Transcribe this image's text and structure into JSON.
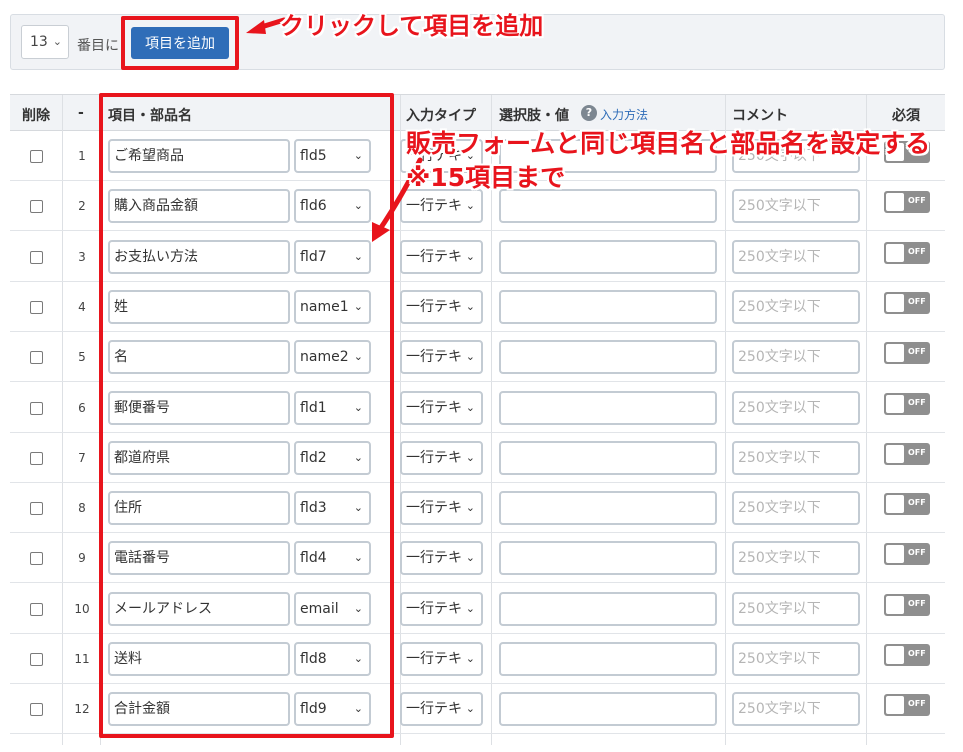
{
  "toolbar": {
    "position_value": "13",
    "position_suffix": "番目に",
    "add_button": "項目を追加"
  },
  "annotations": {
    "add_hint": "クリックして項目を追加",
    "main_line1": "販売フォームと同じ項目名と部品名を設定する",
    "main_line2": "※15項目まで"
  },
  "table": {
    "headers": {
      "delete": "削除",
      "num": "-",
      "name": "項目・部品名",
      "type": "入力タイプ",
      "choices": "選択肢・値",
      "choices_help": "入力方法",
      "comment": "コメント",
      "required": "必須"
    },
    "rows": [
      {
        "num": "1",
        "name": "ご希望商品",
        "part": "fld5",
        "type": "一行テキ",
        "comment_ph": "250文字以下",
        "toggle": "OFF"
      },
      {
        "num": "2",
        "name": "購入商品金額",
        "part": "fld6",
        "type": "一行テキ",
        "comment_ph": "250文字以下",
        "toggle": "OFF"
      },
      {
        "num": "3",
        "name": "お支払い方法",
        "part": "fld7",
        "type": "一行テキ",
        "comment_ph": "250文字以下",
        "toggle": "OFF"
      },
      {
        "num": "4",
        "name": "姓",
        "part": "name1",
        "type": "一行テキ",
        "comment_ph": "250文字以下",
        "toggle": "OFF"
      },
      {
        "num": "5",
        "name": "名",
        "part": "name2",
        "type": "一行テキ",
        "comment_ph": "250文字以下",
        "toggle": "OFF"
      },
      {
        "num": "6",
        "name": "郵便番号",
        "part": "fld1",
        "type": "一行テキ",
        "comment_ph": "250文字以下",
        "toggle": "OFF"
      },
      {
        "num": "7",
        "name": "都道府県",
        "part": "fld2",
        "type": "一行テキ",
        "comment_ph": "250文字以下",
        "toggle": "OFF"
      },
      {
        "num": "8",
        "name": "住所",
        "part": "fld3",
        "type": "一行テキ",
        "comment_ph": "250文字以下",
        "toggle": "OFF"
      },
      {
        "num": "9",
        "name": "電話番号",
        "part": "fld4",
        "type": "一行テキ",
        "comment_ph": "250文字以下",
        "toggle": "OFF"
      },
      {
        "num": "10",
        "name": "メールアドレス",
        "part": "email",
        "type": "一行テキ",
        "comment_ph": "250文字以下",
        "toggle": "OFF"
      },
      {
        "num": "11",
        "name": "送料",
        "part": "fld8",
        "type": "一行テキ",
        "comment_ph": "250文字以下",
        "toggle": "OFF"
      },
      {
        "num": "12",
        "name": "合計金額",
        "part": "fld9",
        "type": "一行テキ",
        "comment_ph": "250文字以下",
        "toggle": "OFF"
      }
    ]
  },
  "icons": {
    "caret": "chevron-down-icon",
    "help": "question-circle-icon"
  },
  "colors": {
    "accent": "#2f6db8",
    "annotation_red": "#e8141c",
    "toggle_off": "#8f8f8f"
  }
}
